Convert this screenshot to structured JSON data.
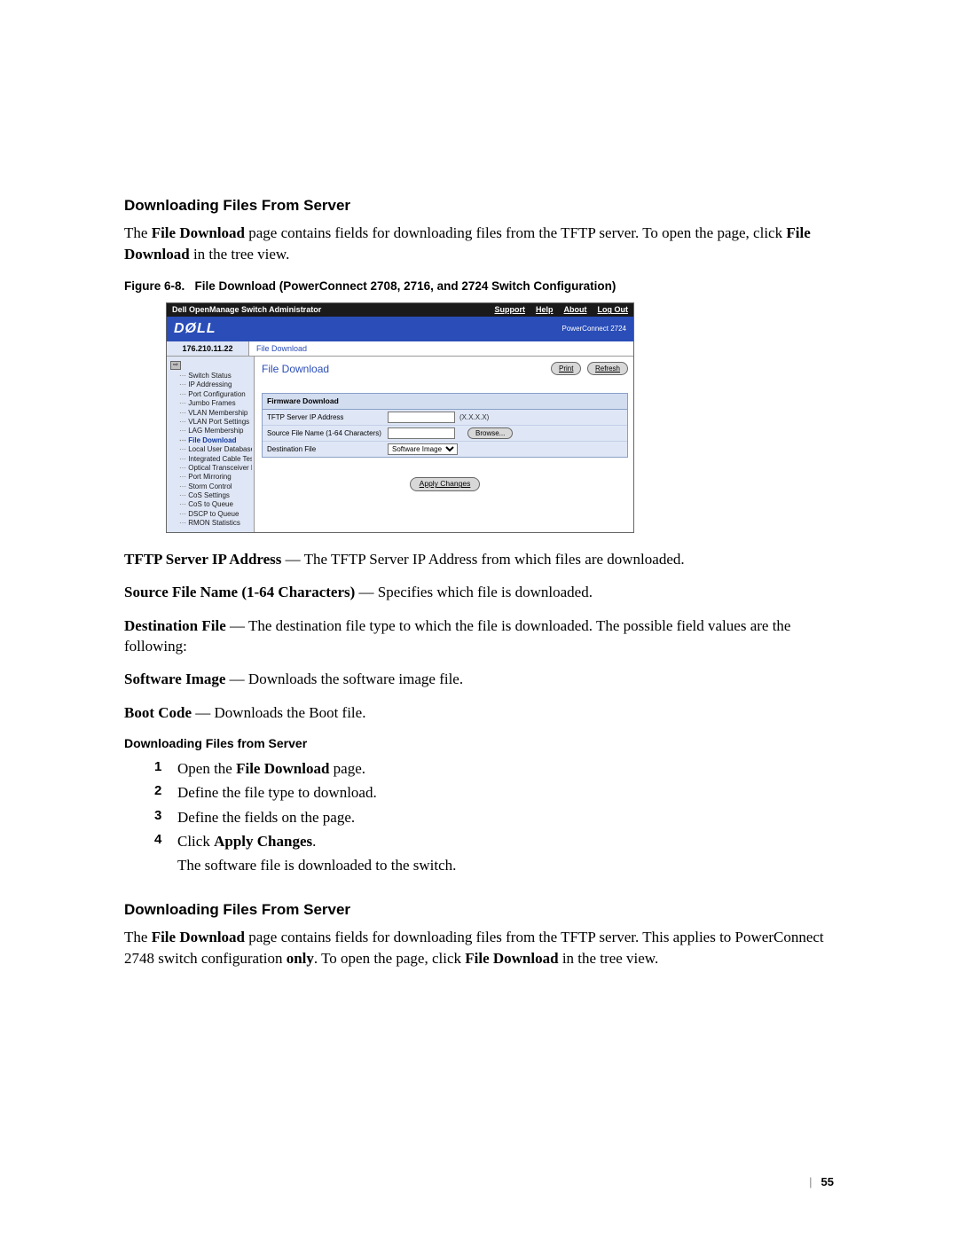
{
  "section1_title": "Downloading Files From Server",
  "section1_body_pre": "The ",
  "section1_body_b1": "File Download",
  "section1_body_mid": " page contains fields for downloading files from the TFTP server. To open the page, click ",
  "section1_body_b2": "File Download",
  "section1_body_post": " in the tree view.",
  "figure_caption_pre": "Figure 6-8.",
  "figure_caption_txt": "File Download (PowerConnect 2708, 2716, and 2724 Switch Configuration)",
  "shot": {
    "top_title": "Dell OpenManage Switch Administrator",
    "nav_support": "Support",
    "nav_help": "Help",
    "nav_about": "About",
    "nav_logout": "Log Out",
    "logo": "DØLL",
    "model": "PowerConnect 2724",
    "ip": "176.210.11.22",
    "breadcrumb": "File Download",
    "tree": [
      "Switch Status",
      "IP Addressing",
      "Port Configuration",
      "Jumbo Frames",
      "VLAN Membership",
      "VLAN Port Settings",
      "LAG Membership",
      "File Download",
      "Local User Database",
      "Integrated Cable Test",
      "Optical Transceiver Dia",
      "Port Mirroring",
      "Storm Control",
      "CoS Settings",
      "CoS to Queue",
      "DSCP to Queue",
      "RMON Statistics"
    ],
    "tree_active_index": 7,
    "h1": "File Download",
    "btn_print": "Print",
    "btn_refresh": "Refresh",
    "panel_header": "Firmware Download",
    "row1_label": "TFTP Server IP Address",
    "row1_hint": "(X.X.X.X)",
    "row2_label": "Source File Name (1-64 Characters)",
    "row2_browse": "Browse...",
    "row3_label": "Destination File",
    "row3_select": "Software Image",
    "btn_apply": "Apply Changes"
  },
  "def1_b": "TFTP Server IP Address",
  "def1_t": " — The TFTP Server IP Address from which files are downloaded.",
  "def2_b": "Source File Name (1-64 Characters)",
  "def2_t": " — Specifies which file is downloaded.",
  "def3_b": "Destination File",
  "def3_t": " — The destination file type to which the file is downloaded. The possible field values are the following:",
  "def3a_b": "Software Image",
  "def3a_t": " — Downloads the software image file.",
  "def3b_b": "Boot Code",
  "def3b_t": " — Downloads the Boot file.",
  "subhead": "Downloading Files from Server",
  "steps": {
    "n1": "1",
    "s1_pre": "Open the ",
    "s1_b": "File Download",
    "s1_post": " page.",
    "n2": "2",
    "s2": "Define the file type to download.",
    "n3": "3",
    "s3": "Define the fields on the page.",
    "n4": "4",
    "s4_pre": "Click ",
    "s4_b": "Apply Changes",
    "s4_post": ".",
    "s4_extra": "The software file is downloaded to the switch."
  },
  "section2_title": "Downloading Files From Server",
  "section2_pre": "The ",
  "section2_b1": "File Download",
  "section2_mid1": " page contains fields for downloading files from the TFTP server. This applies to PowerConnect 2748 switch configuration ",
  "section2_b_only": "only",
  "section2_mid2": ". To open the page, click ",
  "section2_b2": "File Download",
  "section2_post": " in the tree view.",
  "page_number": "55"
}
